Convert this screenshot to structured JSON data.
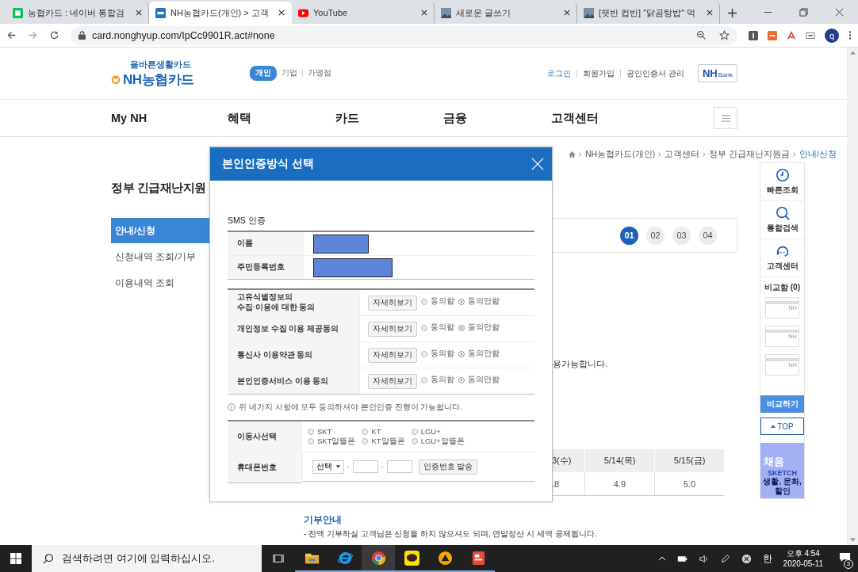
{
  "browser": {
    "tabs": [
      {
        "title": "농협카드 : 네이버 통합검",
        "kind": "green",
        "selected": false
      },
      {
        "title": "NH농협카드(개인) > 고객",
        "kind": "blue",
        "selected": true
      },
      {
        "title": "YouTube",
        "kind": "play",
        "selected": false
      },
      {
        "title": "새로운 글쓰기",
        "kind": "photo",
        "selected": false
      },
      {
        "title": "[햇반 컵반] \"닭곰탕밥\" 먹",
        "kind": "photo",
        "selected": false
      }
    ],
    "url": "card.nonghyup.com/IpCc9901R.act#none",
    "profile": "q"
  },
  "header": {
    "slogan": "올바른생활카드",
    "logo": "NH농협카드",
    "segments": [
      {
        "label": "개인",
        "selected": true
      },
      {
        "label": "기업",
        "selected": false
      },
      {
        "label": "가맹점",
        "selected": false
      }
    ],
    "links": [
      {
        "label": "로그인",
        "kind": "accent"
      },
      {
        "label": "회원가입",
        "kind": "plain"
      },
      {
        "label": "공인인증서 관리",
        "kind": "plain"
      }
    ],
    "bank_button": {
      "strong": "NH",
      "small": "Bank"
    }
  },
  "nav": [
    "My NH",
    "혜택",
    "카드",
    "금융",
    "고객센터"
  ],
  "breadcrumb": [
    "NH농협카드(개인)",
    "고객센터",
    "정부 긴급재난지원금",
    "안내/신청"
  ],
  "page_title": "정부 긴급재난지원",
  "side_menu": [
    {
      "label": "안내/신청",
      "selected": true
    },
    {
      "label": "신청내역 조회/기부",
      "selected": false
    },
    {
      "label": "이용내역 조회",
      "selected": false
    }
  ],
  "steps": [
    {
      "label": "01",
      "selected": true
    },
    {
      "label": "02",
      "selected": false
    },
    {
      "label": "03",
      "selected": false
    },
    {
      "label": "04",
      "selected": false
    }
  ],
  "notice_fragment": "용가능합니다.",
  "table": {
    "columns": [
      "3(수)",
      "5/14(목)",
      "5/15(금)"
    ],
    "rows": [
      [
        ".8",
        "4.9",
        "5.0"
      ]
    ]
  },
  "donation": {
    "title": "기부안내",
    "text": "- 전액 기부하실 고객님은 신청을 하지 않으셔도 되며, 연말정산 시 세액 공제됩니다."
  },
  "quickbar": {
    "items": [
      {
        "label": "빠른조회",
        "kind": "clock"
      },
      {
        "label": "통합검색",
        "kind": "search"
      },
      {
        "label": "고객센터",
        "kind": "headset"
      }
    ],
    "compare_title": "비교함 (0)",
    "slots": [
      "NH",
      "NH",
      "NH"
    ],
    "compare_button": "비교하기",
    "top_button": "TOP",
    "banner": {
      "title": "채움",
      "subtitle": "SKETCH",
      "tagline": "생활, 문화, 할인"
    }
  },
  "modal": {
    "title": "본인인증방식 선택",
    "section": "SMS 인증",
    "fields": [
      {
        "label": "이름",
        "kind": "short"
      },
      {
        "label": "주민등록번호",
        "kind": "long"
      }
    ],
    "consents": [
      {
        "label": "고유식별정보의\n수집·이용에 대한 동의",
        "button": "자세히보기",
        "options": [
          {
            "label": "동의함",
            "selected": false
          },
          {
            "label": "동의안함",
            "selected": true
          }
        ]
      },
      {
        "label": "개인정보 수집 이용 제공동의",
        "button": "자세히보기",
        "options": [
          {
            "label": "동의함",
            "selected": false
          },
          {
            "label": "동의안함",
            "selected": true
          }
        ]
      },
      {
        "label": "통신사 이용약관 동의",
        "button": "자세히보기",
        "options": [
          {
            "label": "동의함",
            "selected": false
          },
          {
            "label": "동의안함",
            "selected": true
          }
        ]
      },
      {
        "label": "본인인증서비스 이용 동의",
        "button": "자세히보기",
        "options": [
          {
            "label": "동의함",
            "selected": false
          },
          {
            "label": "동의안함",
            "selected": true
          }
        ]
      }
    ],
    "note": "위 네가지 사항에 모두 동의하셔야 본인인증 진행이 가능합니다.",
    "carrier": {
      "label": "이동사선택",
      "options": [
        {
          "label": "SKT",
          "selected": false
        },
        {
          "label": "KT",
          "selected": false
        },
        {
          "label": "LGU+",
          "selected": false
        },
        {
          "label": "SKT알뜰폰",
          "selected": false
        },
        {
          "label": "KT알뜰폰",
          "selected": false
        },
        {
          "label": "LGU+알뜰폰",
          "selected": false
        }
      ]
    },
    "phone": {
      "label": "휴대폰번호",
      "select": "선택",
      "separators": [
        "-",
        "-"
      ],
      "button": "인증번호 발송"
    }
  },
  "taskbar": {
    "search_placeholder": "검색하려면 여기에 입력하십시오.",
    "apps": [
      {
        "kind": "folder",
        "selected": false
      },
      {
        "kind": "ie",
        "selected": false
      },
      {
        "kind": "chrome",
        "selected": true
      },
      {
        "kind": "chat",
        "selected": false
      },
      {
        "kind": "circle",
        "selected": false
      },
      {
        "kind": "red",
        "selected": false
      }
    ],
    "ime": "한",
    "time": "오후 4:54",
    "date": "2020-05-11",
    "notifications": "3"
  }
}
